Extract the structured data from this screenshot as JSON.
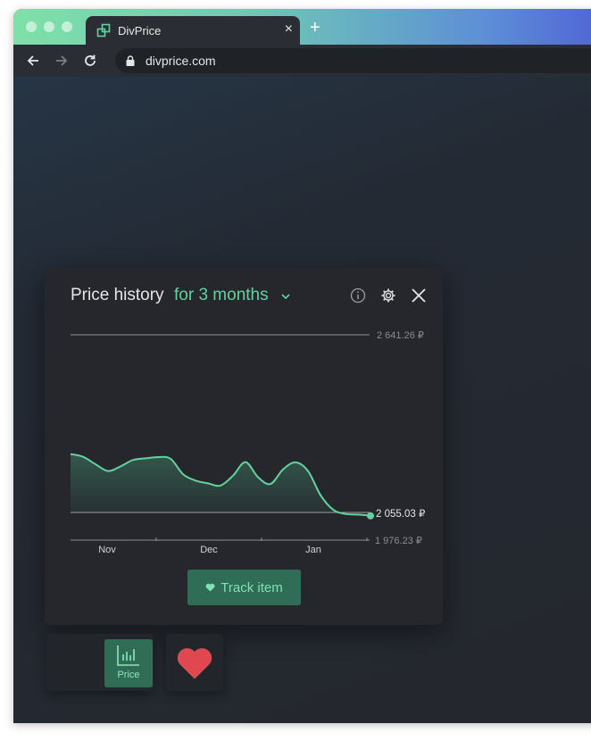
{
  "browser": {
    "tab_title": "DivPrice",
    "url": "divprice.com",
    "new_tab_symbol": "+",
    "close_tab_symbol": "×"
  },
  "widget": {
    "title": "Price history",
    "range": "for 3 months",
    "track_button": "Track item",
    "price_tab_label": "Price"
  },
  "colors": {
    "accent": "#63d29e",
    "button_bg": "#2f6d57",
    "panel_bg": "#25272c",
    "heart": "#e0474f"
  },
  "chart_data": {
    "type": "area",
    "x_labels": [
      "Nov",
      "Dec",
      "Jan"
    ],
    "max_label": "2 641.26 ₽",
    "current_label": "2 055.03 ₽",
    "min_label": "1 976.23 ₽",
    "ylim": [
      1976.23,
      2641.26
    ],
    "current": 2055.03,
    "series": [
      {
        "values": [
          2255,
          2246,
          2222,
          2200,
          2215,
          2236,
          2241,
          2245,
          2240,
          2190,
          2169,
          2160,
          2153,
          2185,
          2229,
          2180,
          2158,
          2205,
          2228,
          2200,
          2122,
          2075,
          2061,
          2059,
          2055
        ]
      }
    ]
  }
}
